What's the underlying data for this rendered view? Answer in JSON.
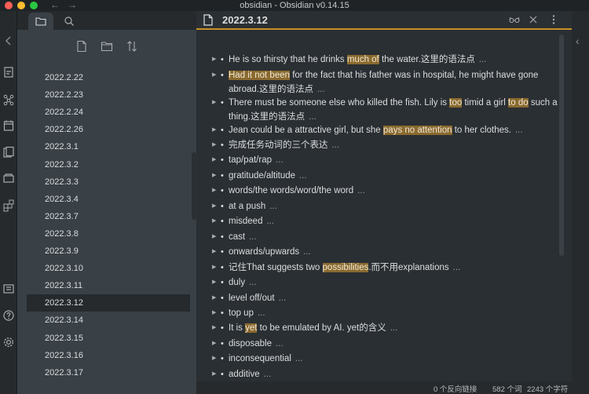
{
  "window": {
    "title": "obsidian - Obsidian v0.14.15",
    "back_arrow": "←",
    "forward_arrow": "→"
  },
  "ribbon_icons": [
    "open-quick-switcher-icon",
    "graph-view-icon",
    "daily-note-icon",
    "templates-icon",
    "slides-icon",
    "command-palette-icon",
    "vault-icon",
    "help-icon",
    "settings-icon"
  ],
  "sidebar": {
    "tab_icons": [
      "file-explorer-icon",
      "search-icon"
    ],
    "toolbar_icons": [
      "new-note-icon",
      "new-folder-icon",
      "sort-icon"
    ],
    "files": [
      {
        "label": "2022.2.22"
      },
      {
        "label": "2022.2.23"
      },
      {
        "label": "2022.2.24"
      },
      {
        "label": "2022.2.26"
      },
      {
        "label": "2022.3.1"
      },
      {
        "label": "2022.3.2"
      },
      {
        "label": "2022.3.3"
      },
      {
        "label": "2022.3.4"
      },
      {
        "label": "2022.3.7"
      },
      {
        "label": "2022.3.8"
      },
      {
        "label": "2022.3.9"
      },
      {
        "label": "2022.3.10"
      },
      {
        "label": "2022.3.11"
      },
      {
        "label": "2022.3.12",
        "active": true
      },
      {
        "label": "2022.3.14"
      },
      {
        "label": "2022.3.15"
      },
      {
        "label": "2022.3.16"
      },
      {
        "label": "2022.3.17"
      }
    ]
  },
  "editor": {
    "title": "2022.3.12",
    "header_icons": [
      "reading-view-icon",
      "close-icon",
      "more-options-icon"
    ],
    "ellipsis": "...",
    "lines": [
      {
        "segments": [
          {
            "t": "He is so thirsty that he drinks "
          },
          {
            "t": "much of",
            "hl": true
          },
          {
            "t": " the water.这里的语法点"
          }
        ]
      },
      {
        "segments": [
          {
            "t": "Had it not been",
            "hl": true
          },
          {
            "t": " for the fact that his father was in hospital, he might have gone abroad.这里的语法点"
          }
        ]
      },
      {
        "segments": [
          {
            "t": "There must be someone else who killed the fish. Lily is "
          },
          {
            "t": "too",
            "hl": true
          },
          {
            "t": " timid a girl "
          },
          {
            "t": "to do",
            "hl": true
          },
          {
            "t": " such a thing.这里的语法点"
          }
        ]
      },
      {
        "segments": [
          {
            "t": "Jean could be a attractive girl, but she "
          },
          {
            "t": "pays no attention",
            "hl": true
          },
          {
            "t": " to her clothes."
          }
        ]
      },
      {
        "segments": [
          {
            "t": "完成任务动词的三个表达"
          }
        ]
      },
      {
        "segments": [
          {
            "t": "tap/pat/rap"
          }
        ]
      },
      {
        "segments": [
          {
            "t": "gratitude/altitude"
          }
        ]
      },
      {
        "segments": [
          {
            "t": "words/the words/word/the word"
          }
        ]
      },
      {
        "segments": [
          {
            "t": "at a push"
          }
        ]
      },
      {
        "segments": [
          {
            "t": "misdeed"
          }
        ]
      },
      {
        "segments": [
          {
            "t": "cast"
          }
        ]
      },
      {
        "segments": [
          {
            "t": "onwards/upwards"
          }
        ]
      },
      {
        "segments": [
          {
            "t": "记住That suggests two "
          },
          {
            "t": "possibilities",
            "hl": true
          },
          {
            "t": ".而不用explanations"
          }
        ]
      },
      {
        "segments": [
          {
            "t": "duly"
          }
        ]
      },
      {
        "segments": [
          {
            "t": "level off/out"
          }
        ]
      },
      {
        "segments": [
          {
            "t": "top up"
          }
        ]
      },
      {
        "segments": [
          {
            "t": "It is "
          },
          {
            "t": "yet",
            "hl": true
          },
          {
            "t": " to be emulated by AI. yet的含义"
          }
        ]
      },
      {
        "segments": [
          {
            "t": "disposable"
          }
        ]
      },
      {
        "segments": [
          {
            "t": "inconsequential"
          }
        ]
      },
      {
        "segments": [
          {
            "t": "additive"
          }
        ]
      }
    ]
  },
  "status": {
    "backlinks": "0 个反向链接",
    "words": "582 个词",
    "chars": "2243 个字符"
  },
  "colors": {
    "accent": "#c69026",
    "highlight": "#8a6a2f",
    "sidebar_bg": "#394046",
    "editor_bg": "#2a2f33"
  }
}
